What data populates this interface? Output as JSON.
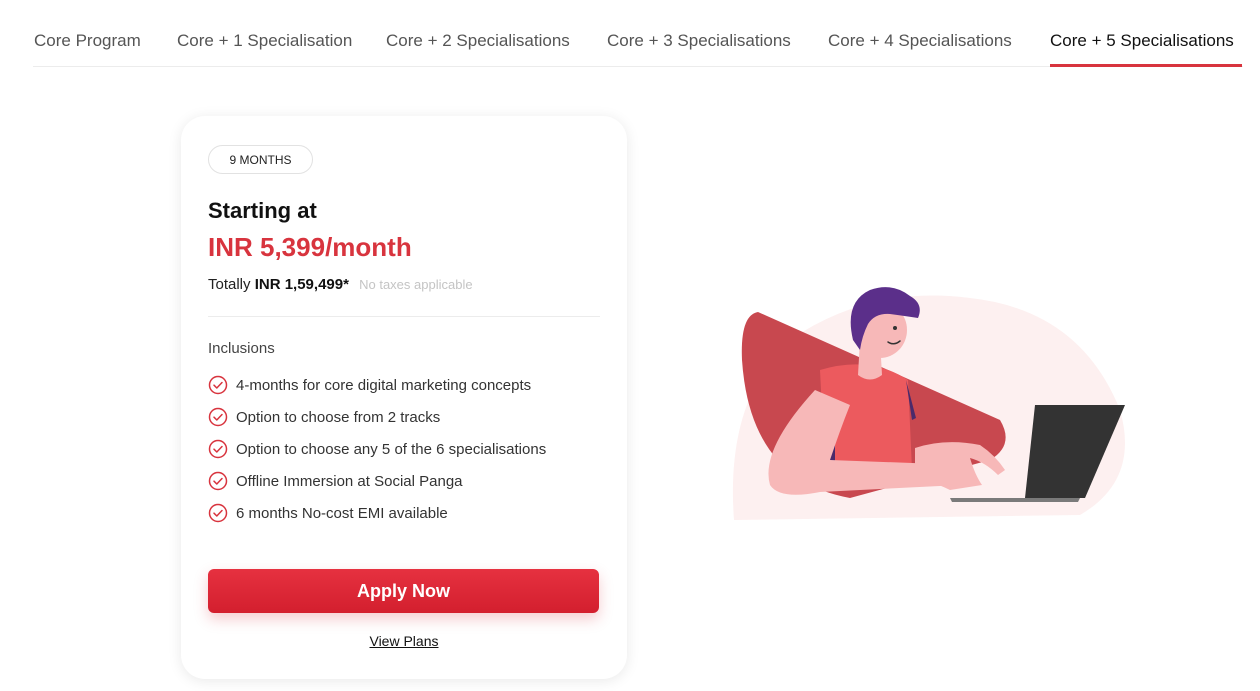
{
  "tabs": [
    {
      "label": "Core Program"
    },
    {
      "label": "Core + 1 Specialisation"
    },
    {
      "label": "Core + 2 Specialisations"
    },
    {
      "label": "Core + 3 Specialisations"
    },
    {
      "label": "Core + 4 Specialisations"
    },
    {
      "label": "Core + 5 Specialisations"
    }
  ],
  "active_tab": "Core + 5 Specialisations",
  "card": {
    "duration_badge": "9 MONTHS",
    "starting_label": "Starting at",
    "monthly_price": "INR 5,399/month",
    "total_prefix": "Totally",
    "total_amount": "INR 1,59,499*",
    "tax_note": "No taxes applicable",
    "inclusions_title": "Inclusions",
    "inclusions": [
      "4-months for core digital marketing concepts",
      "Option to choose from 2 tracks",
      "Option to choose any 5 of the 6 specialisations",
      "Offline Immersion at Social Panga",
      "6 months No-cost EMI available"
    ],
    "apply_label": "Apply Now",
    "view_plans_label": "View Plans"
  },
  "icons": {
    "inclusion": "check-circle-icon"
  },
  "colors": {
    "accent": "#d8343e",
    "accent_button": "#e02a38",
    "illustration_pink": "#fdf0f0",
    "laptop": "#333333"
  }
}
